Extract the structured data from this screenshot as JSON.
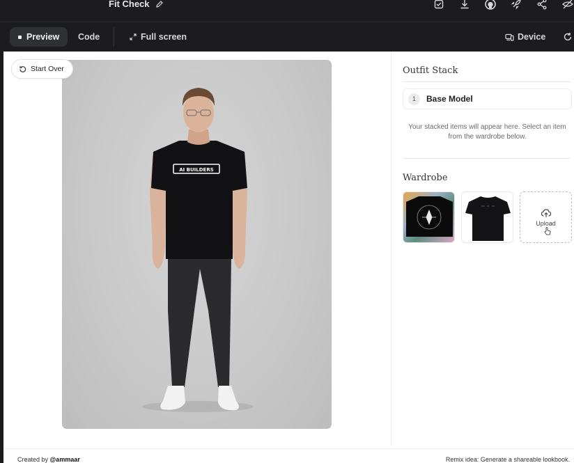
{
  "topbar": {
    "title": "Fit Check",
    "icons": [
      "edit-pencil-icon",
      "save-icon",
      "download-icon",
      "github-icon",
      "deploy-rocket-icon",
      "share-icon",
      "hide-icon"
    ]
  },
  "toolbar": {
    "preview_label": "Preview",
    "code_label": "Code",
    "fullscreen_label": "Full screen",
    "device_label": "Device"
  },
  "app": {
    "start_over_label": "Start Over",
    "outfit_stack": {
      "title": "Outfit Stack",
      "items": [
        {
          "number": "1",
          "label": "Base Model"
        }
      ],
      "hint": "Your stacked items will appear here. Select an item from the wardrobe below."
    },
    "wardrobe": {
      "title": "Wardrobe",
      "upload_label": "Upload"
    },
    "shirt_print": "AI BUILDERS"
  },
  "footer": {
    "created_by_prefix": "Created by ",
    "created_by_name": "@ammaar",
    "remix": "Remix idea: Generate a shareable lookbook."
  }
}
